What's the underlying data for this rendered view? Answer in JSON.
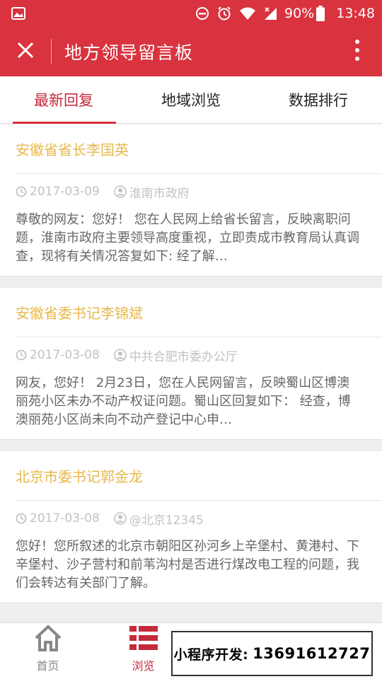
{
  "status_bar": {
    "battery": "90%",
    "time": "13:48",
    "bg_color": "#d9333f"
  },
  "nav": {
    "title": "地方领导留言板",
    "close_icon": "close-icon",
    "more_icon": "more-vertical-icon"
  },
  "tabs": [
    {
      "label": "最新回复",
      "active": true
    },
    {
      "label": "地域浏览",
      "active": false
    },
    {
      "label": "数据排行",
      "active": false
    }
  ],
  "cards": [
    {
      "title": "安徽省省长李国英",
      "date": "2017-03-09",
      "author": "淮南市政府",
      "body": "尊敬的网友：您好！ 您在人民网上给省长留言，反映离职问题，淮南市政府主要领导高度重视，立即责成市教育局认真调查，现将有关情况答复如下: 经了解…"
    },
    {
      "title": "安徽省委书记李锦斌",
      "date": "2017-03-08",
      "author": "中共合肥市委办公厅",
      "body": "网友，您好！ 2月23日，您在人民网留言，反映蜀山区博澳丽苑小区未办不动产权证问题。蜀山区回复如下： 经查，博澳丽苑小区尚未向不动产登记中心申…"
    },
    {
      "title": "北京市委书记郭金龙",
      "date": "2017-03-08",
      "author": "@北京12345",
      "body": "您好！您所叙述的北京市朝阳区孙河乡上辛堡村、黄港村、下辛堡村、沙子营村和前苇沟村是否进行煤改电工程的问题，我们会转达有关部门了解。"
    }
  ],
  "bottom_nav": [
    {
      "label": "首页",
      "icon": "home-icon",
      "active": false
    },
    {
      "label": "浏览",
      "icon": "list-icon",
      "active": true
    }
  ],
  "overlay": {
    "label": "小程序开发:",
    "phone": "13691612727"
  },
  "colors": {
    "accent": "#d9333f",
    "title_gold": "#e8b84a",
    "meta_gray": "#c2c2c2"
  }
}
